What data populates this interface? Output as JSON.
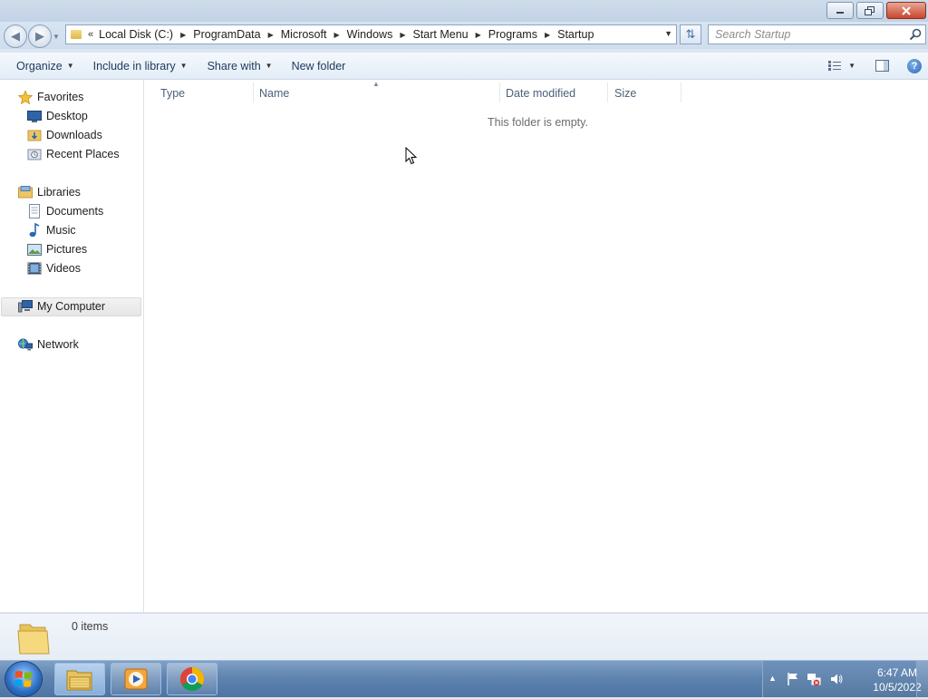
{
  "window": {
    "minimize_label": "minimize",
    "restore_label": "restore",
    "close_label": "close"
  },
  "address": {
    "chevron": "«",
    "crumbs": [
      "Local Disk (C:)",
      "ProgramData",
      "Microsoft",
      "Windows",
      "Start Menu",
      "Programs",
      "Startup"
    ]
  },
  "search": {
    "placeholder": "Search Startup"
  },
  "toolbar": {
    "organize": "Organize",
    "include_in_library": "Include in library",
    "share_with": "Share with",
    "new_folder": "New folder"
  },
  "nav": {
    "favorites": "Favorites",
    "desktop": "Desktop",
    "downloads": "Downloads",
    "recent_places": "Recent Places",
    "libraries": "Libraries",
    "documents": "Documents",
    "music": "Music",
    "pictures": "Pictures",
    "videos": "Videos",
    "my_computer": "My Computer",
    "network": "Network"
  },
  "columns": {
    "type": "Type",
    "name": "Name",
    "date_modified": "Date modified",
    "size": "Size"
  },
  "content": {
    "empty_message": "This folder is empty."
  },
  "details": {
    "item_count": "0 items"
  },
  "taskbar": {
    "apps": [
      "windows-explorer-icon",
      "media-player-icon",
      "chrome-icon"
    ],
    "clock_time": "6:47 AM",
    "clock_date": "10/5/2022"
  },
  "colors": {
    "selection": "#e6e6e6",
    "link_text": "#1e395b",
    "column_text": "#4c607a",
    "taskbar": "#5f84b0"
  }
}
